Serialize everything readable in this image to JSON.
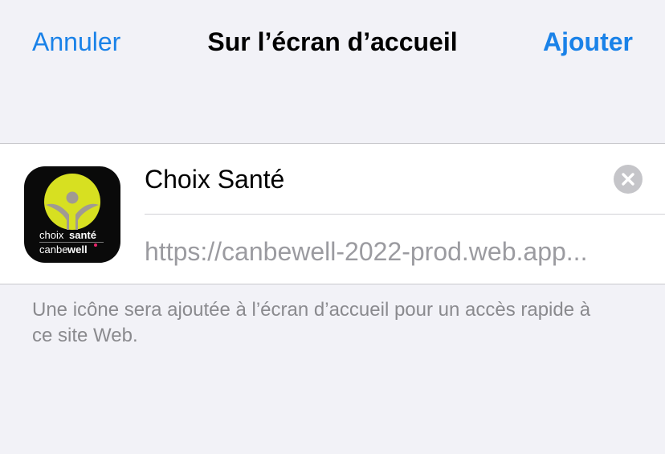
{
  "nav": {
    "cancel_label": "Annuler",
    "title": "Sur l’écran d’accueil",
    "add_label": "Ajouter"
  },
  "bookmark": {
    "name_value": "Choix Santé",
    "url": "https://canbewell-2022-prod.web.app...",
    "icon": {
      "name": "app-icon-choix-sante",
      "line1_left": "choix",
      "line1_right": "santé",
      "line2_left": "canbe",
      "line2_right": "well"
    },
    "clear_icon": "clear-x-icon"
  },
  "footnote": "Une icône sera ajoutée à l’écran d’accueil pour un accès rapide à ce site Web.",
  "colors": {
    "accent": "#1a82e8",
    "background": "#f2f2f7",
    "icon_background": "#0a0a0a",
    "icon_circle": "#d7e021",
    "icon_figure": "#a09a92",
    "icon_heart": "#e8246a"
  }
}
